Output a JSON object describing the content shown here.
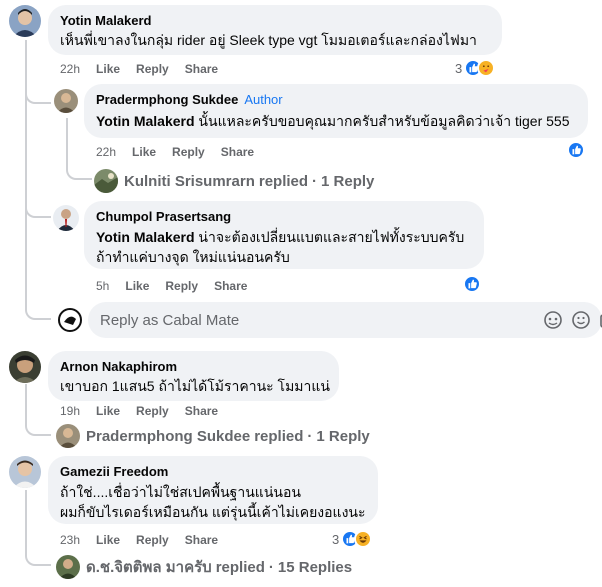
{
  "comments": [
    {
      "author": "Yotin Malakerd",
      "text": "เห็นพี่เขาลงในกลุ่ม rider อยู่ Sleek type vgt โมมอเตอร์และกล่องไฟมา",
      "time": "22h",
      "like_label": "Like",
      "reply_label": "Reply",
      "share_label": "Share",
      "reaction_count": "3",
      "replies": [
        {
          "author": "Pradermphong Sukdee",
          "badge": "Author",
          "mention": "Yotin Malakerd",
          "text": " นั้นแหละครับขอบคุณมากครับสำหรับข้อมูลคิดว่าเจ้า tiger 555",
          "time": "22h",
          "like_label": "Like",
          "reply_label": "Reply",
          "share_label": "Share"
        }
      ],
      "replied_summary": {
        "name": "Kulniti Srisumrarn",
        "action": "replied",
        "count": "1 Reply"
      },
      "reply2": {
        "author": "Chumpol Prasertsang",
        "mention": "Yotin Malakerd",
        "line1": " น่าจะต้องเปลี่ยนแบตและสายไฟทั้งระบบครับ",
        "line2": "ถ้าทำแค่บางจุด ใหม่แน่นอนครับ",
        "time": "5h",
        "like_label": "Like",
        "reply_label": "Reply",
        "share_label": "Share"
      },
      "reply_input_placeholder": "Reply as Cabal Mate"
    },
    {
      "author": "Arnon Nakaphirom",
      "text": "เขาบอก 1แสน5 ถ้าไม่ได้โม้ราคานะ โมมาแน่",
      "time": "19h",
      "like_label": "Like",
      "reply_label": "Reply",
      "share_label": "Share",
      "replied_summary": {
        "name": "Pradermphong Sukdee",
        "action": "replied",
        "count": "1 Reply"
      }
    },
    {
      "author": "Gamezii Freedom",
      "line1": "ถ้าใช่....เชื่อว่าไม่ใช่สเปคพื้นฐานแน่นอน",
      "line2": "ผมก็ขับไรเดอร์เหมือนกัน แต่รุ่นนี้เค้าไม่เคยงอแงนะ",
      "time": "23h",
      "like_label": "Like",
      "reply_label": "Reply",
      "share_label": "Share",
      "reaction_count": "3",
      "replied_summary": {
        "name": "ด.ช.จิตติพล มาครับ",
        "action": "replied",
        "count": "15 Replies"
      }
    }
  ],
  "separator": "·",
  "colors": {
    "bubble": "#f0f2f5",
    "meta": "#65676b",
    "accent": "#1877f2",
    "thread_line": "#ced0d4"
  }
}
